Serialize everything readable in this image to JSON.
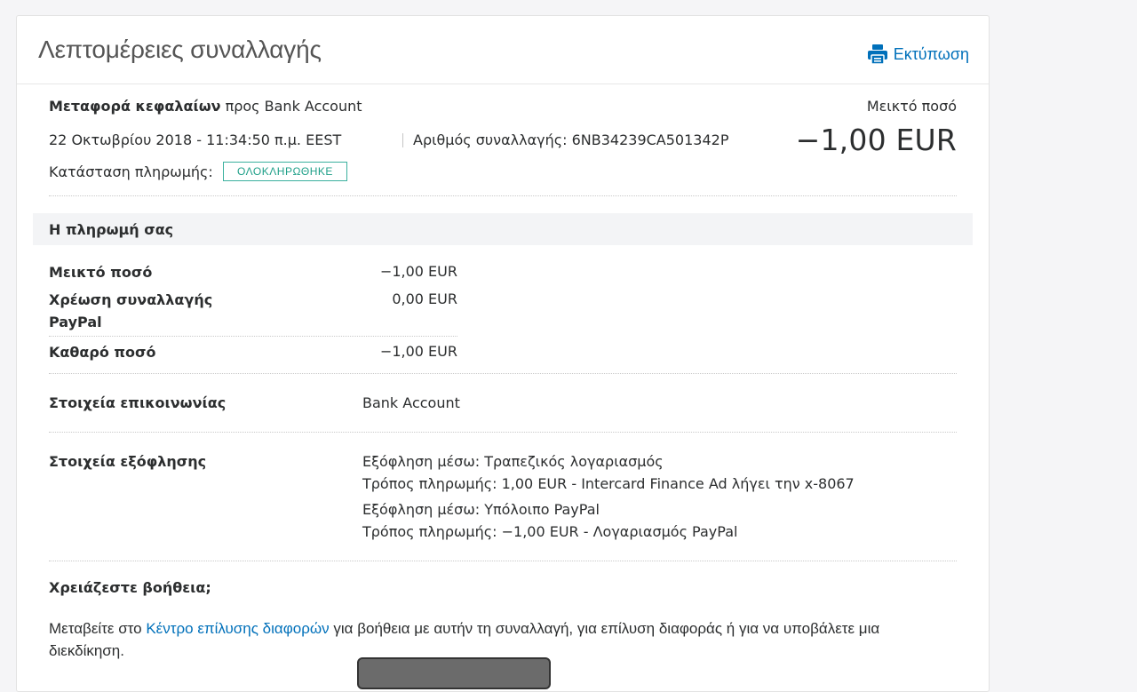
{
  "header": {
    "title": "Λεπτομέρειες συναλλαγής",
    "print_label": "Εκτύπωση"
  },
  "summary": {
    "transfer_bold": "Μεταφορά κεφαλαίων",
    "transfer_rest": " προς Bank Account",
    "date": "22 Οκτωβρίου 2018 - 11:34:50 π.μ. EEST",
    "txn_id": "Αριθμός συναλλαγής: 6NB34239CA501342P",
    "status_label": "Κατάσταση πληρωμής:",
    "status_badge": "ΟΛΟΚΛΗΡΩΘΗΚΕ",
    "gross_label": "Μεικτό ποσό",
    "gross_amount": "−1,00 EUR"
  },
  "payment": {
    "section_title": "Η πληρωμή σας",
    "rows": [
      {
        "label": "Μεικτό ποσό",
        "value": "−1,00 EUR"
      },
      {
        "label_line1": "Χρέωση συναλλαγής",
        "label_line2": "PayPal",
        "value": "0,00 EUR"
      },
      {
        "label": "Καθαρό ποσό",
        "value": "−1,00 EUR"
      }
    ]
  },
  "contact": {
    "label": "Στοιχεία επικοινωνίας",
    "value": "Bank Account"
  },
  "funding": {
    "label": "Στοιχεία εξόφλησης",
    "lines": [
      "Εξόφληση μέσω: Τραπεζικός λογαριασμός",
      "Τρόπος πληρωμής: 1,00 EUR - Intercard Finance Ad λήγει την x-8067",
      "Εξόφληση μέσω: Υπόλοιπο PayPal",
      "Τρόπος πληρωμής: −1,00 EUR - Λογαριασμός PayPal"
    ]
  },
  "help": {
    "title": "Χρειάζεστε βοήθεια;",
    "text_before": "Μεταβείτε στο ",
    "link": "Κέντρο επίλυσης διαφορών",
    "text_after": " για βοήθεια με αυτήν τη συναλλαγή, για επίλυση διαφοράς ή για να υποβάλετε μια διεκδίκηση."
  },
  "colors": {
    "link": "#0070ba",
    "status": "#1e9f88"
  }
}
